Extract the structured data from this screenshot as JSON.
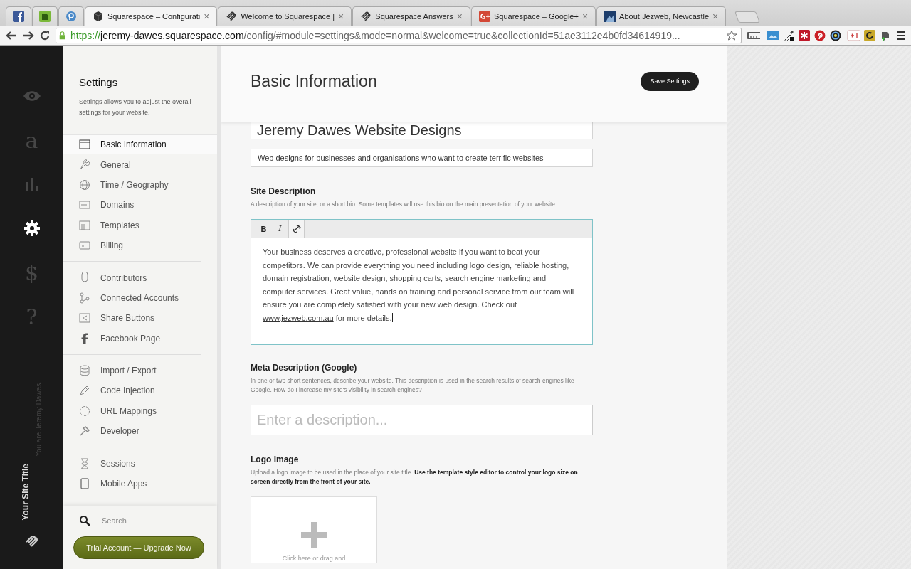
{
  "browser": {
    "tabs": [
      {
        "selected": false
      },
      {
        "selected": false
      },
      {
        "selected": false
      },
      {
        "title": "Squarespace – Configurati",
        "selected": true
      },
      {
        "title": "Welcome to Squarespace |",
        "selected": false
      },
      {
        "title": "Squarespace Answers",
        "selected": false
      },
      {
        "title": "Squarespace – Google+",
        "selected": false
      },
      {
        "title": "About Jezweb, Newcastle",
        "selected": false
      }
    ],
    "close_glyph": "×",
    "url": {
      "scheme": "https://",
      "host": "jeremy-dawes.squarespace.com",
      "path": "/config/#module=settings&mode=normal&welcome=true&collectionId=51ae3112e4b0fd34614919..."
    }
  },
  "rail": {
    "items": [
      {
        "kind": "eye",
        "selected": false
      },
      {
        "kind": "glyph",
        "glyph": "a",
        "selected": false
      },
      {
        "kind": "chart",
        "selected": false
      },
      {
        "kind": "gear",
        "selected": true
      },
      {
        "kind": "glyph",
        "glyph": "$",
        "selected": false
      },
      {
        "kind": "glyph",
        "glyph": "?",
        "selected": false
      }
    ],
    "user_note": "You are Jeremy Dawes.",
    "site_title": "Your Site Title"
  },
  "sidebar": {
    "title": "Settings",
    "description": "Settings allows you to adjust the overall settings for your website.",
    "groups": [
      [
        {
          "label": "Basic Information",
          "selected": true
        },
        {
          "label": "General",
          "selected": false
        },
        {
          "label": "Time / Geography",
          "selected": false
        },
        {
          "label": "Domains",
          "selected": false
        },
        {
          "label": "Templates",
          "selected": false
        },
        {
          "label": "Billing",
          "selected": false
        }
      ],
      [
        {
          "label": "Contributors",
          "selected": false
        },
        {
          "label": "Connected Accounts",
          "selected": false
        },
        {
          "label": "Share Buttons",
          "selected": false
        },
        {
          "label": "Facebook Page",
          "selected": false
        }
      ],
      [
        {
          "label": "Import / Export",
          "selected": false
        },
        {
          "label": "Code Injection",
          "selected": false
        },
        {
          "label": "URL Mappings",
          "selected": false
        },
        {
          "label": "Developer",
          "selected": false
        }
      ],
      [
        {
          "label": "Sessions",
          "selected": false
        },
        {
          "label": "Mobile Apps",
          "selected": false
        }
      ]
    ],
    "search": {
      "placeholder": "Search"
    },
    "upgrade_button": "Trial Account — Upgrade Now"
  },
  "main": {
    "title": "Basic Information",
    "save_button": "Save Settings",
    "site_title": {
      "value": "Jeremy Dawes Website Designs"
    },
    "tagline": {
      "value": "Web designs for businesses and organisations who want to create terrific websites"
    },
    "site_description": {
      "label": "Site Description",
      "hint": "A description of your site, or a short bio. Some templates will use this bio on the main presentation of your website.",
      "toolbar": [
        "B",
        "I"
      ],
      "text_before": "Your business deserves a creative, professional website if you want to beat your competitors. We can provide everything you need including logo design, reliable hosting, domain registration, website design, shopping carts, search engine marketing and computer services. Great value, hands on training and personal service from our team will ensure you are completely satisfied with your new web design. Check out ",
      "link": "www.jezweb.com.au",
      "text_after": " for more details."
    },
    "meta_description": {
      "label": "Meta Description (Google)",
      "hint": "In one or two short sentences, describe your website. This description is used in the search results of search engines like Google. How do I increase my site's visibility in search engines?",
      "placeholder": "Enter a description..."
    },
    "logo_image": {
      "label": "Logo Image",
      "hint": "Upload a logo image to be used in the place of your site title. **Use the template style editor to control your logo size on screen directly from the front of your site.**",
      "upload_text": "Click here or drag and"
    }
  }
}
